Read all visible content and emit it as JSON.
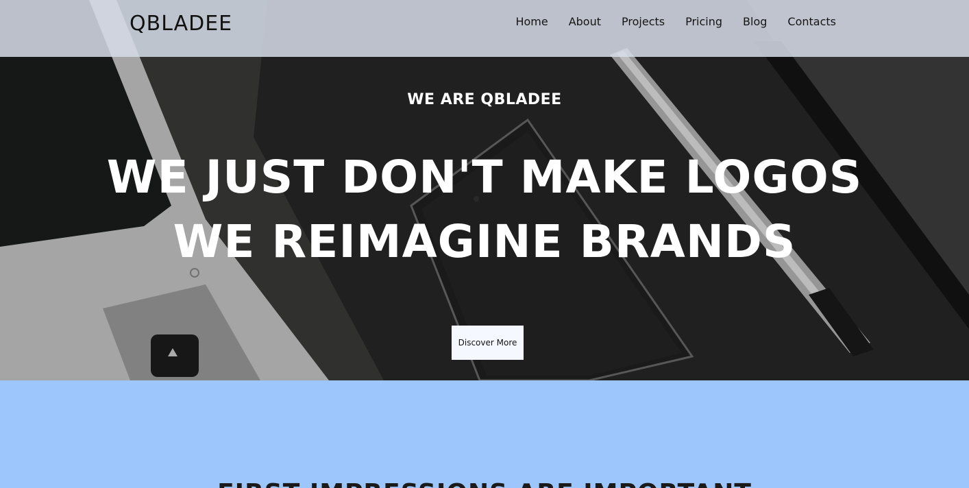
{
  "brand": {
    "name": "QBLADEE"
  },
  "nav": {
    "items": [
      {
        "label": "Home"
      },
      {
        "label": "About"
      },
      {
        "label": "Projects"
      },
      {
        "label": "Pricing"
      },
      {
        "label": "Blog"
      },
      {
        "label": "Contacts"
      }
    ]
  },
  "hero": {
    "eyebrow": "WE ARE QBLADEE",
    "headline_line1": "WE JUST DON'T MAKE LOGOS",
    "headline_line2": "WE REIMAGINE BRANDS",
    "cta_label": "Discover More"
  },
  "section": {
    "title": "FIRST IMPRESSIONS ARE IMPORTANT"
  },
  "colors": {
    "navbar_bg": "#d6dce8",
    "section_bg": "#9cc6fc",
    "cta_bg": "#f5f8ff",
    "hero_text": "#ffffff"
  }
}
